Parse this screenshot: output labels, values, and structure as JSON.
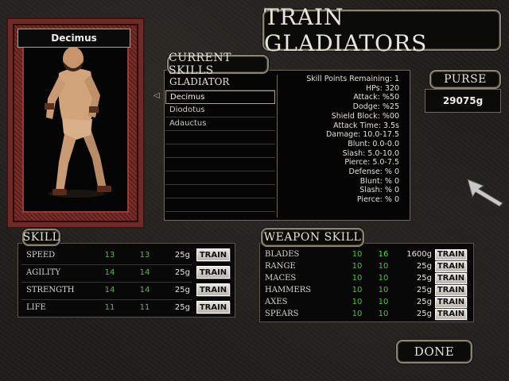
{
  "title": "TRAIN GLADIATORS",
  "gladiator_name": "Decimus",
  "current_skills": {
    "header": "CURRENT SKILLS",
    "list_header": "GLADIATOR",
    "gladiators": [
      "Decimus",
      "Diodotus",
      "Adauctus"
    ],
    "selected_index": 0,
    "stats": [
      "Skill Points Remaining: 1",
      "HPs: 320",
      "Attack: %50",
      "Dodge: %25",
      "Shield Block: %00",
      "Attack Time: 3.5s",
      "Damage: 10.0-17.5",
      "Blunt: 0.0-0.0",
      "Slash: 5.0-10.0",
      "Pierce: 5.0-7.5",
      "Defense: % 0",
      "Blunt: % 0",
      "Slash: % 0",
      "Pierce: % 0"
    ]
  },
  "purse": {
    "label": "PURSE",
    "amount": "29075g"
  },
  "skill": {
    "header": "SKILL",
    "rows": [
      {
        "name": "SPEED",
        "current": "13",
        "max": "13",
        "cost": "25g",
        "button": "TRAIN"
      },
      {
        "name": "AGILITY",
        "current": "14",
        "max": "14",
        "cost": "25g",
        "button": "TRAIN"
      },
      {
        "name": "STRENGTH",
        "current": "14",
        "max": "14",
        "cost": "25g",
        "button": "TRAIN"
      },
      {
        "name": "LIFE",
        "current": "11",
        "max": "11",
        "cost": "25g",
        "button": "TRAIN"
      }
    ]
  },
  "weapon_skill": {
    "header": "WEAPON SKILL",
    "rows": [
      {
        "name": "BLADES",
        "current": "10",
        "max": "16",
        "cost": "1600g",
        "button": "TRAIN"
      },
      {
        "name": "RANGE",
        "current": "10",
        "max": "10",
        "cost": "25g",
        "button": "TRAIN"
      },
      {
        "name": "MACES",
        "current": "10",
        "max": "10",
        "cost": "25g",
        "button": "TRAIN"
      },
      {
        "name": "HAMMERS",
        "current": "10",
        "max": "10",
        "cost": "25g",
        "button": "TRAIN"
      },
      {
        "name": "AXES",
        "current": "10",
        "max": "10",
        "cost": "25g",
        "button": "TRAIN"
      },
      {
        "name": "SPEARS",
        "current": "10",
        "max": "10",
        "cost": "25g",
        "button": "TRAIN"
      }
    ]
  },
  "done_label": "DONE",
  "colors": {
    "value_green": "#4ec040",
    "portrait_red": "#6e2a26",
    "panel_border": "#8c8472"
  }
}
